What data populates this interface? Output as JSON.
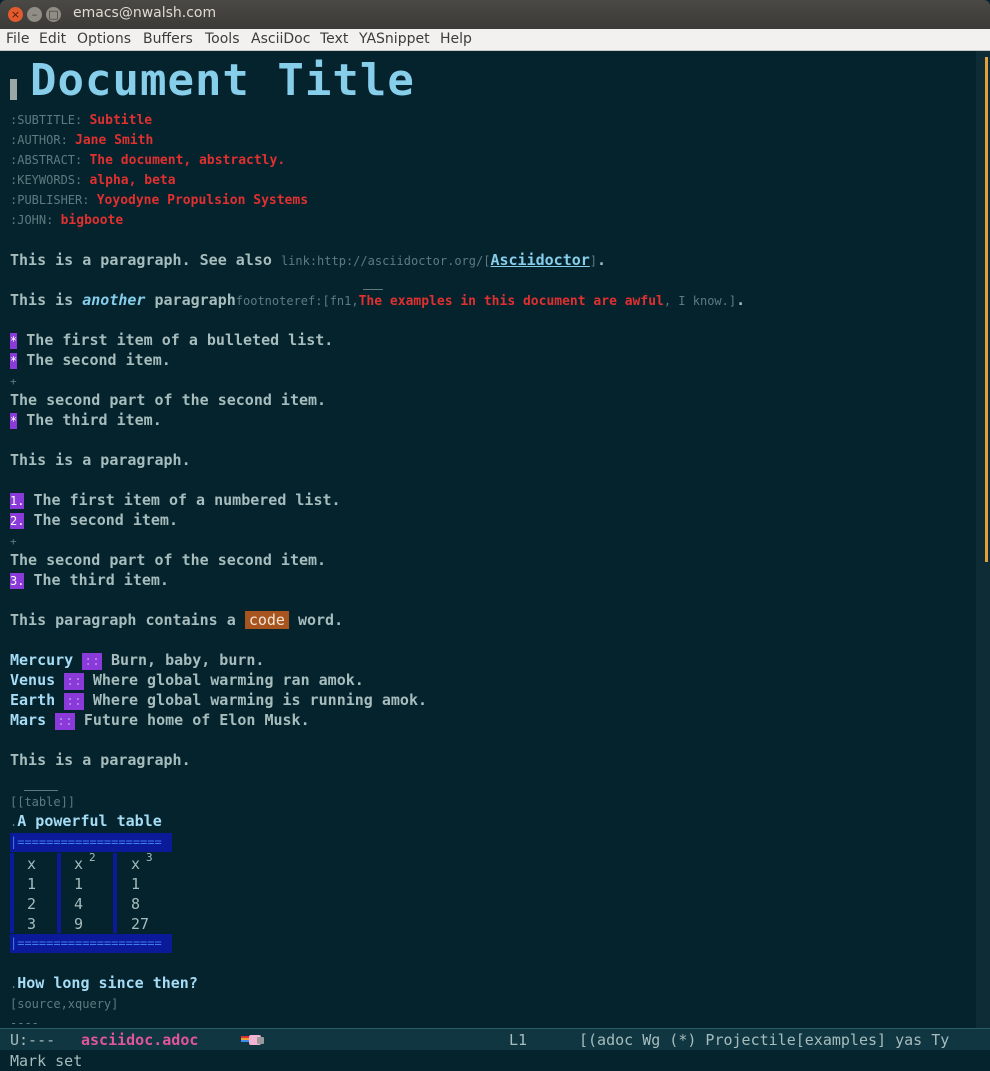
{
  "window": {
    "title": "emacs@nwalsh.com"
  },
  "menu": [
    "File",
    "Edit",
    "Options",
    "Buffers",
    "Tools",
    "AsciiDoc",
    "Text",
    "YASnippet",
    "Help"
  ],
  "doc": {
    "title": "Document Title",
    "meta": [
      {
        "key": ":SUBTITLE:",
        "value": "Subtitle"
      },
      {
        "key": ":AUTHOR:",
        "value": "Jane Smith"
      },
      {
        "key": ":ABSTRACT:",
        "value": "The document, abstractly."
      },
      {
        "key": ":KEYWORDS:",
        "value": "alpha, beta"
      },
      {
        "key": ":PUBLISHER:",
        "value": "Yoyodyne Propulsion Systems"
      },
      {
        "key": ":JOHN:",
        "value": "bigboote"
      }
    ],
    "para1": {
      "pre": "This is a paragraph. See also ",
      "link_markup": "link:http://asciidoctor.org/[",
      "link_text": "Asciidoctor",
      "link_close": "]",
      "post": "."
    },
    "para2": {
      "pre": "This is ",
      "emph": "another",
      "mid": " paragraph",
      "fn_markup": "footnoteref:[fn1,",
      "fn_text": "The examples in this document are awful",
      "fn_tail": ", I know.]",
      "post": "."
    },
    "bullets": {
      "marker": "*",
      "item1": "The first item of a bulleted list.",
      "item2": "The second item.",
      "plus": "+",
      "cont": "The second part of the second item.",
      "item3": "The third item."
    },
    "para3": "This is a paragraph.",
    "numbered": {
      "m1": "1.",
      "item1": "The first item of a numbered list.",
      "m2": "2.",
      "item2": "The second item.",
      "plus": "+",
      "cont": "The second part of the second item.",
      "m3": "3.",
      "item3": "The third item."
    },
    "codepara": {
      "pre": "This paragraph contains a ",
      "code": "code",
      "post": " word."
    },
    "dlist": [
      {
        "term": "Mercury",
        "sep": "::",
        "desc": "Burn, baby, burn."
      },
      {
        "term": "Venus",
        "sep": "::",
        "desc": "Where global warming ran amok."
      },
      {
        "term": "Earth",
        "sep": "::",
        "desc": "Where global warming is running amok."
      },
      {
        "term": "Mars",
        "sep": "::",
        "desc": "Future home of Elon Musk."
      }
    ],
    "para4": "This is a paragraph.",
    "table": {
      "anchor": "[[table]]",
      "caption": "A powerful table",
      "border": "|====================",
      "headers": [
        "x",
        "x",
        "x"
      ],
      "sups": [
        "2",
        "3"
      ],
      "rows": [
        [
          "1",
          "1",
          "1"
        ],
        [
          "2",
          "4",
          "8"
        ],
        [
          "3",
          "9",
          "27"
        ]
      ]
    },
    "caption2": "How long since then?",
    "source_attr": "[source,xquery]",
    "dashes": "----"
  },
  "modeline": {
    "status": "U:---",
    "buffer": "asciidoc.adoc",
    "line": "L1",
    "modes": "[(adoc Wg (*) Projectile[examples] yas Ty"
  },
  "minibuffer": "Mark set",
  "colors": {
    "bg": "#04232d",
    "title": "#87ceeb",
    "meta_value": "#e03030",
    "marker": "#8a3ad8",
    "code": "#a8541f"
  }
}
